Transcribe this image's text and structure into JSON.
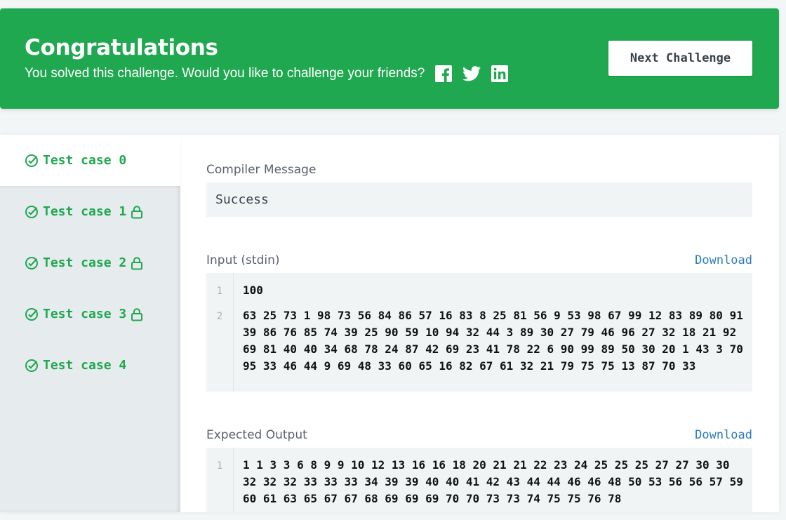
{
  "banner": {
    "title": "Congratulations",
    "subtitle": "You solved this challenge. Would you like to challenge your friends?",
    "social_icons": [
      "facebook-icon",
      "twitter-icon",
      "linkedin-icon"
    ],
    "next_button": "Next Challenge",
    "color": "#1fa84f"
  },
  "test_cases": [
    {
      "label": "Test case 0",
      "locked": false,
      "active": true
    },
    {
      "label": "Test case 1",
      "locked": true,
      "active": false
    },
    {
      "label": "Test case 2",
      "locked": true,
      "active": false
    },
    {
      "label": "Test case 3",
      "locked": true,
      "active": false
    },
    {
      "label": "Test case 4",
      "locked": false,
      "active": false
    }
  ],
  "compiler": {
    "label": "Compiler Message",
    "message": "Success"
  },
  "input": {
    "label": "Input (stdin)",
    "download": "Download",
    "lines": [
      {
        "num": "1",
        "text": "100"
      },
      {
        "num": "2",
        "text": "63 25 73 1 98 73 56 84 86 57 16 83 8 25 81 56 9 53 98 67 99 12 83 89 80 91 39 86 76 85 74 39 25 90 59 10 94 32 44 3 89 30 27 79 46 96 27 32 18 21 92 69 81 40 40 34 68 78 24 87 42 69 23 41 78 22 6 90 99 89 50 30 20 1 43 3 70 95 33 46 44 9 69 48 33 60 65 16 82 67 61 32 21 79 75 75 13 87 70 33"
      }
    ]
  },
  "expected": {
    "label": "Expected Output",
    "download": "Download",
    "lines": [
      {
        "num": "1",
        "text": "1 1 3 3 6 8 9 9 10 12 13 16 16 18 20 21 21 22 23 24 25 25 25 27 27 30 30 32 32 32 33 33 33 34 39 39 40 40 41 42 43 44 44 46 46 48 50 53 56 56 57 59 60 61 63 65 67 67 68 69 69 69 70 70 73 73 74 75 75 76 78"
      }
    ]
  }
}
